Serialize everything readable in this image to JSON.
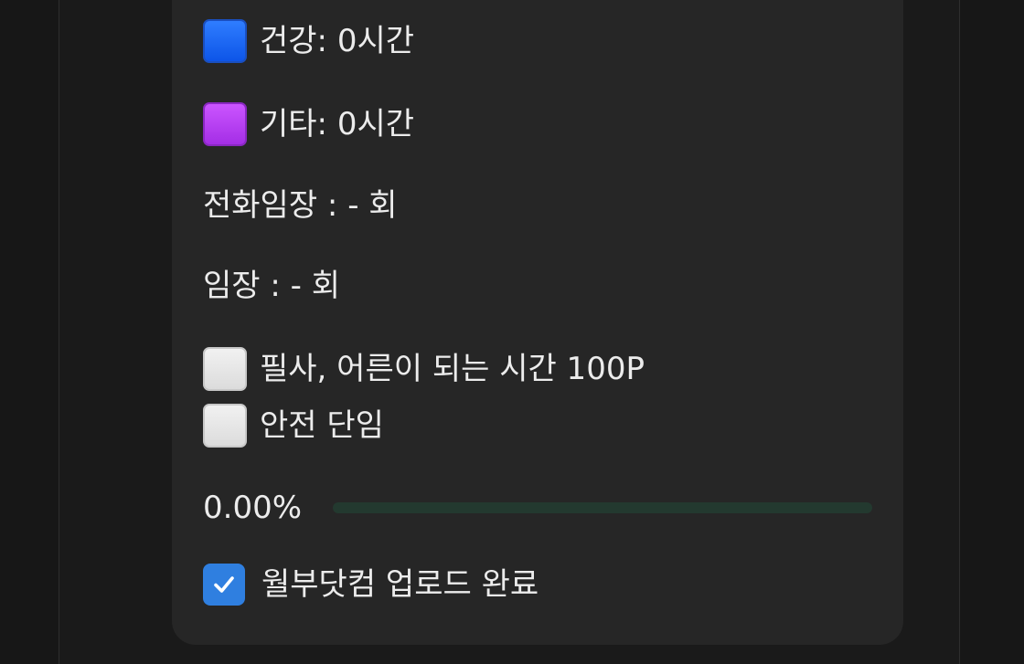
{
  "categories": [
    {
      "label": "건강: 0시간",
      "color": "#1565f5",
      "icon": "blue-square-icon"
    },
    {
      "label": "기타: 0시간",
      "color": "#b43ef2",
      "icon": "purple-square-icon"
    }
  ],
  "stats": {
    "phone_visits": "전화임장 : - 회",
    "visits": "임장 : - 회"
  },
  "tasks": [
    {
      "label": "필사, 어른이 되는 시간 100P",
      "checked": false
    },
    {
      "label": "안전 단임",
      "checked": false
    }
  ],
  "progress": {
    "text": "0.00%",
    "value": 0
  },
  "completion": {
    "label": "월부닷컴 업로드 완료",
    "checked": true
  },
  "colors": {
    "accent": "#2f7fe0",
    "progress_track": "#23392f"
  }
}
